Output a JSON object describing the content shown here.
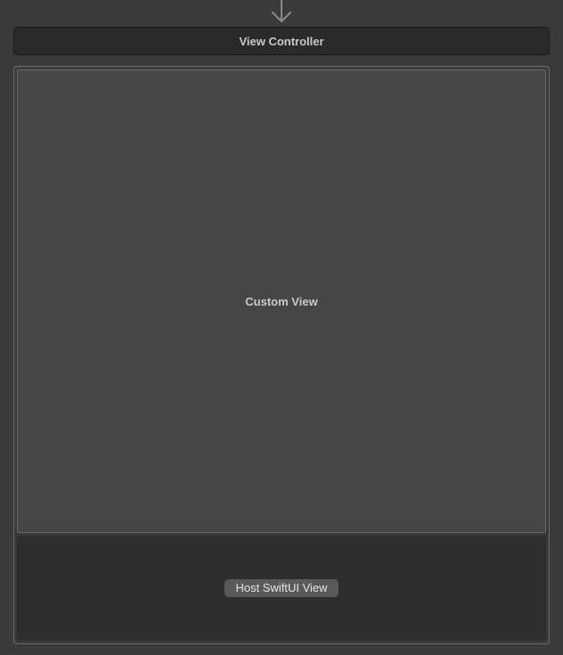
{
  "scene": {
    "title": "View Controller",
    "custom_view_label": "Custom View",
    "host_button_label": "Host SwiftUI View"
  }
}
